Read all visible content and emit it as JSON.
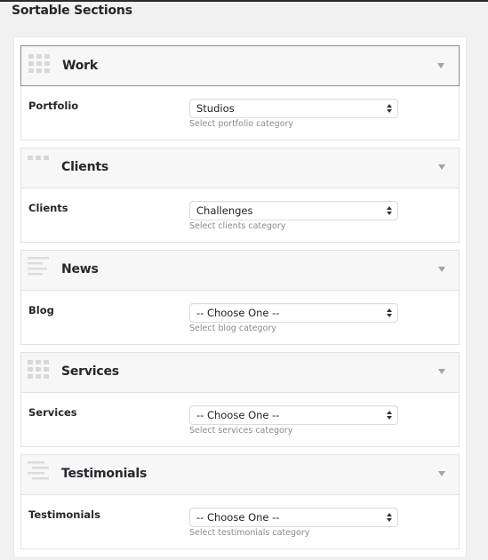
{
  "page": {
    "title": "Sortable Sections"
  },
  "colors": {
    "background": "#f1f1f1",
    "panel": "#ffffff",
    "section_header": "#f7f7f7",
    "active_border": "#8c8c8c",
    "help_text": "#8a8a8a",
    "icon": "#d8d8d8"
  },
  "sections": [
    {
      "title": "Work",
      "icon": "grid-icon",
      "active": true,
      "field_label": "Portfolio",
      "select_value": "Studios",
      "help_text": "Select portfolio category"
    },
    {
      "title": "Clients",
      "icon": "dots-row-icon",
      "active": false,
      "field_label": "Clients",
      "select_value": "Challenges",
      "help_text": "Select clients category"
    },
    {
      "title": "News",
      "icon": "lines-left-icon",
      "active": false,
      "field_label": "Blog",
      "select_value": "-- Choose One --",
      "help_text": "Select blog category"
    },
    {
      "title": "Services",
      "icon": "grid-icon",
      "active": false,
      "field_label": "Services",
      "select_value": "-- Choose One --",
      "help_text": "Select services category"
    },
    {
      "title": "Testimonials",
      "icon": "lines-right-icon",
      "active": false,
      "field_label": "Testimonials",
      "select_value": "-- Choose One --",
      "help_text": "Select testimonials category"
    }
  ]
}
